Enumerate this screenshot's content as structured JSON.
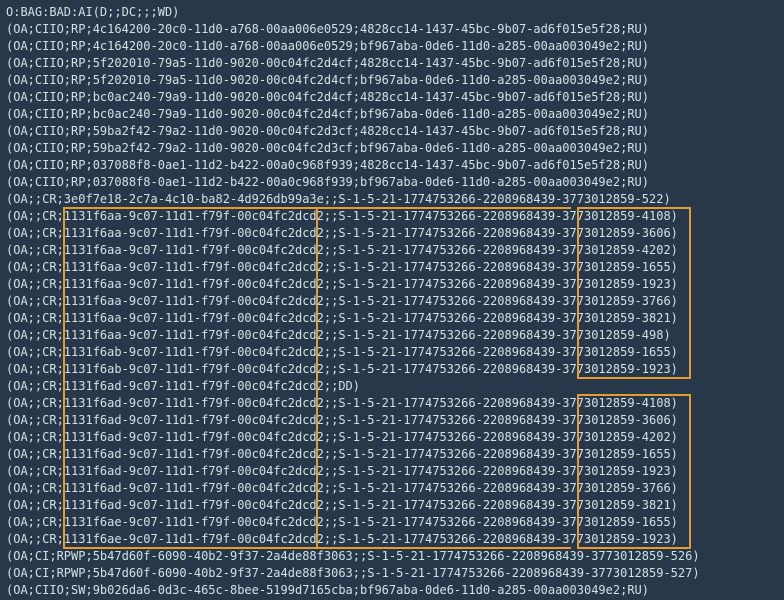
{
  "terminal": {
    "lines": [
      "O:BAG:BAD:AI(D;;DC;;;WD)",
      "(OA;CIIO;RP;4c164200-20c0-11d0-a768-00aa006e0529;4828cc14-1437-45bc-9b07-ad6f015e5f28;RU)",
      "(OA;CIIO;RP;4c164200-20c0-11d0-a768-00aa006e0529;bf967aba-0de6-11d0-a285-00aa003049e2;RU)",
      "(OA;CIIO;RP;5f202010-79a5-11d0-9020-00c04fc2d4cf;4828cc14-1437-45bc-9b07-ad6f015e5f28;RU)",
      "(OA;CIIO;RP;5f202010-79a5-11d0-9020-00c04fc2d4cf;bf967aba-0de6-11d0-a285-00aa003049e2;RU)",
      "(OA;CIIO;RP;bc0ac240-79a9-11d0-9020-00c04fc2d4cf;4828cc14-1437-45bc-9b07-ad6f015e5f28;RU)",
      "(OA;CIIO;RP;bc0ac240-79a9-11d0-9020-00c04fc2d4cf;bf967aba-0de6-11d0-a285-00aa003049e2;RU)",
      "(OA;CIIO;RP;59ba2f42-79a2-11d0-9020-00c04fc2d3cf;4828cc14-1437-45bc-9b07-ad6f015e5f28;RU)",
      "(OA;CIIO;RP;59ba2f42-79a2-11d0-9020-00c04fc2d3cf;bf967aba-0de6-11d0-a285-00aa003049e2;RU)",
      "(OA;CIIO;RP;037088f8-0ae1-11d2-b422-00a0c968f939;4828cc14-1437-45bc-9b07-ad6f015e5f28;RU)",
      "(OA;CIIO;RP;037088f8-0ae1-11d2-b422-00a0c968f939;bf967aba-0de6-11d0-a285-00aa003049e2;RU)",
      "(OA;;CR;3e0f7e18-2c7a-4c10-ba82-4d926db99a3e;;S-1-5-21-1774753266-2208968439-3773012859-522)",
      "(OA;;CR;1131f6aa-9c07-11d1-f79f-00c04fc2dcd2;;S-1-5-21-1774753266-2208968439-3773012859-4108)",
      "(OA;;CR;1131f6aa-9c07-11d1-f79f-00c04fc2dcd2;;S-1-5-21-1774753266-2208968439-3773012859-3606)",
      "(OA;;CR;1131f6aa-9c07-11d1-f79f-00c04fc2dcd2;;S-1-5-21-1774753266-2208968439-3773012859-4202)",
      "(OA;;CR;1131f6aa-9c07-11d1-f79f-00c04fc2dcd2;;S-1-5-21-1774753266-2208968439-3773012859-1655)",
      "(OA;;CR;1131f6aa-9c07-11d1-f79f-00c04fc2dcd2;;S-1-5-21-1774753266-2208968439-3773012859-1923)",
      "(OA;;CR;1131f6aa-9c07-11d1-f79f-00c04fc2dcd2;;S-1-5-21-1774753266-2208968439-3773012859-3766)",
      "(OA;;CR;1131f6aa-9c07-11d1-f79f-00c04fc2dcd2;;S-1-5-21-1774753266-2208968439-3773012859-3821)",
      "(OA;;CR;1131f6aa-9c07-11d1-f79f-00c04fc2dcd2;;S-1-5-21-1774753266-2208968439-3773012859-498)",
      "(OA;;CR;1131f6ab-9c07-11d1-f79f-00c04fc2dcd2;;S-1-5-21-1774753266-2208968439-3773012859-1655)",
      "(OA;;CR;1131f6ab-9c07-11d1-f79f-00c04fc2dcd2;;S-1-5-21-1774753266-2208968439-3773012859-1923)",
      "(OA;;CR;1131f6ad-9c07-11d1-f79f-00c04fc2dcd2;;DD)",
      "(OA;;CR;1131f6ad-9c07-11d1-f79f-00c04fc2dcd2;;S-1-5-21-1774753266-2208968439-3773012859-4108)",
      "(OA;;CR;1131f6ad-9c07-11d1-f79f-00c04fc2dcd2;;S-1-5-21-1774753266-2208968439-3773012859-3606)",
      "(OA;;CR;1131f6ad-9c07-11d1-f79f-00c04fc2dcd2;;S-1-5-21-1774753266-2208968439-3773012859-4202)",
      "(OA;;CR;1131f6ad-9c07-11d1-f79f-00c04fc2dcd2;;S-1-5-21-1774753266-2208968439-3773012859-1655)",
      "(OA;;CR;1131f6ad-9c07-11d1-f79f-00c04fc2dcd2;;S-1-5-21-1774753266-2208968439-3773012859-1923)",
      "(OA;;CR;1131f6ad-9c07-11d1-f79f-00c04fc2dcd2;;S-1-5-21-1774753266-2208968439-3773012859-3766)",
      "(OA;;CR;1131f6ad-9c07-11d1-f79f-00c04fc2dcd2;;S-1-5-21-1774753266-2208968439-3773012859-3821)",
      "(OA;;CR;1131f6ae-9c07-11d1-f79f-00c04fc2dcd2;;S-1-5-21-1774753266-2208968439-3773012859-1655)",
      "(OA;;CR;1131f6ae-9c07-11d1-f79f-00c04fc2dcd2;;S-1-5-21-1774753266-2208968439-3773012859-1923)",
      "(OA;CI;RPWP;5b47d60f-6090-40b2-9f37-2a4de88f3063;;S-1-5-21-1774753266-2208968439-3773012859-526)",
      "(OA;CI;RPWP;5b47d60f-6090-40b2-9f37-2a4de88f3063;;S-1-5-21-1774753266-2208968439-3773012859-527)",
      "(OA;CIIO;SW;9b026da6-0d3c-465c-8bee-5199d7165cba;bf967aba-0de6-11d0-a285-00aa003049e2;RU)"
    ]
  }
}
